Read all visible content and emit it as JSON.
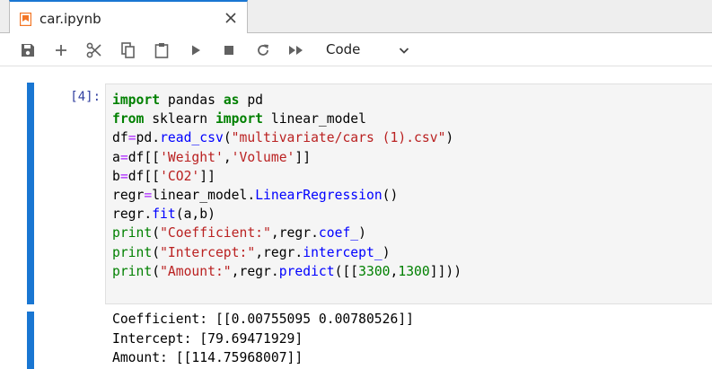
{
  "tab": {
    "title": "car.ipynb",
    "icon": "notebook-icon",
    "close_icon": "close-icon",
    "accent_color": "#1976d2",
    "icon_color": "#f37626"
  },
  "toolbar": {
    "buttons": [
      {
        "name": "save-button",
        "icon": "save-icon"
      },
      {
        "name": "insert-cell-button",
        "icon": "plus-icon"
      },
      {
        "name": "cut-button",
        "icon": "scissors-icon"
      },
      {
        "name": "copy-button",
        "icon": "copy-icon"
      },
      {
        "name": "paste-button",
        "icon": "paste-icon"
      },
      {
        "name": "run-button",
        "icon": "play-icon"
      },
      {
        "name": "interrupt-button",
        "icon": "stop-icon"
      },
      {
        "name": "restart-button",
        "icon": "refresh-icon"
      },
      {
        "name": "run-all-button",
        "icon": "fast-forward-icon"
      }
    ],
    "cell_type": "Code"
  },
  "cell": {
    "prompt": "[4]:",
    "code": {
      "l1": {
        "kw1": "import",
        "mod": " pandas ",
        "kw2": "as",
        "alias": " pd"
      },
      "l2": {
        "kw1": "from",
        "mod": " sklearn ",
        "kw2": "import",
        "name": " linear_model"
      },
      "l3": {
        "a": "df",
        "op": "=",
        "b": "pd.",
        "fn": "read_csv",
        "p1": "(",
        "str": "\"multivariate/cars (1).csv\"",
        "p2": ")"
      },
      "l4": {
        "a": "a",
        "op": "=",
        "b": "df[[",
        "s1": "'Weight'",
        "c": ",",
        "s2": "'Volume'",
        "d": "]]"
      },
      "l5": {
        "a": "b",
        "op": "=",
        "b": "df[[",
        "s1": "'CO2'",
        "d": "]]"
      },
      "l6": {
        "a": "regr",
        "op": "=",
        "b": "linear_model.",
        "fn": "LinearRegression",
        "c": "()"
      },
      "l7": {
        "a": "regr.",
        "fn": "fit",
        "c": "(a,b)"
      },
      "l8": {
        "bi": "print",
        "p1": "(",
        "str": "\"Coefficient:\"",
        "c": ",regr.",
        "attr": "coef_",
        "p2": ")"
      },
      "l9": {
        "bi": "print",
        "p1": "(",
        "str": "\"Intercept:\"",
        "c": ",regr.",
        "attr": "intercept_",
        "p2": ")"
      },
      "l10": {
        "bi": "print",
        "p1": "(",
        "str": "\"Amount:\"",
        "c": ",regr.",
        "fn": "predict",
        "p2": "([[",
        "n1": "3300",
        "comma": ",",
        "n2": "1300",
        "p3": "]]))"
      }
    },
    "output": [
      "Coefficient: [[0.00755095 0.00780526]]",
      "Intercept: [79.69471929]",
      "Amount: [[114.75968007]]"
    ]
  }
}
